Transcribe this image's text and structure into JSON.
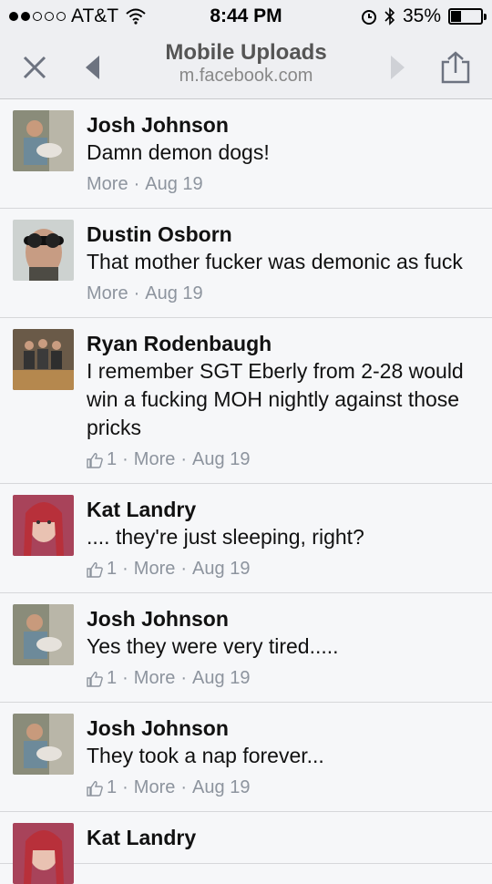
{
  "status_bar": {
    "carrier": "AT&T",
    "time": "8:44 PM",
    "battery": "35%",
    "battery_level": 0.35
  },
  "nav": {
    "title": "Mobile Uploads",
    "url": "m.facebook.com",
    "icons": [
      "close-icon",
      "back-arrow-icon",
      "forward-arrow-icon",
      "share-icon"
    ]
  },
  "comments": [
    {
      "author": "Josh Johnson",
      "text": "Damn demon dogs!",
      "likes": "",
      "more": "More",
      "date": "Aug 19"
    },
    {
      "author": "Dustin Osborn",
      "text": "That mother fucker was demonic as fuck",
      "likes": "",
      "more": "More",
      "date": "Aug 19"
    },
    {
      "author": "Ryan Rodenbaugh",
      "text": "I remember SGT Eberly from 2-28 would win a fucking MOH nightly against those pricks",
      "likes": "1",
      "more": "More",
      "date": "Aug 19"
    },
    {
      "author": "Kat Landry",
      "text": ".... they're just sleeping, right?",
      "likes": "1",
      "more": "More",
      "date": "Aug 19"
    },
    {
      "author": "Josh Johnson",
      "text": "Yes they were very tired.....",
      "likes": "1",
      "more": "More",
      "date": "Aug 19"
    },
    {
      "author": "Josh Johnson",
      "text": "They took a nap forever...",
      "likes": "1",
      "more": "More",
      "date": "Aug 19"
    },
    {
      "author": "Kat Landry",
      "text": "",
      "likes": "",
      "more": "",
      "date": ""
    }
  ]
}
